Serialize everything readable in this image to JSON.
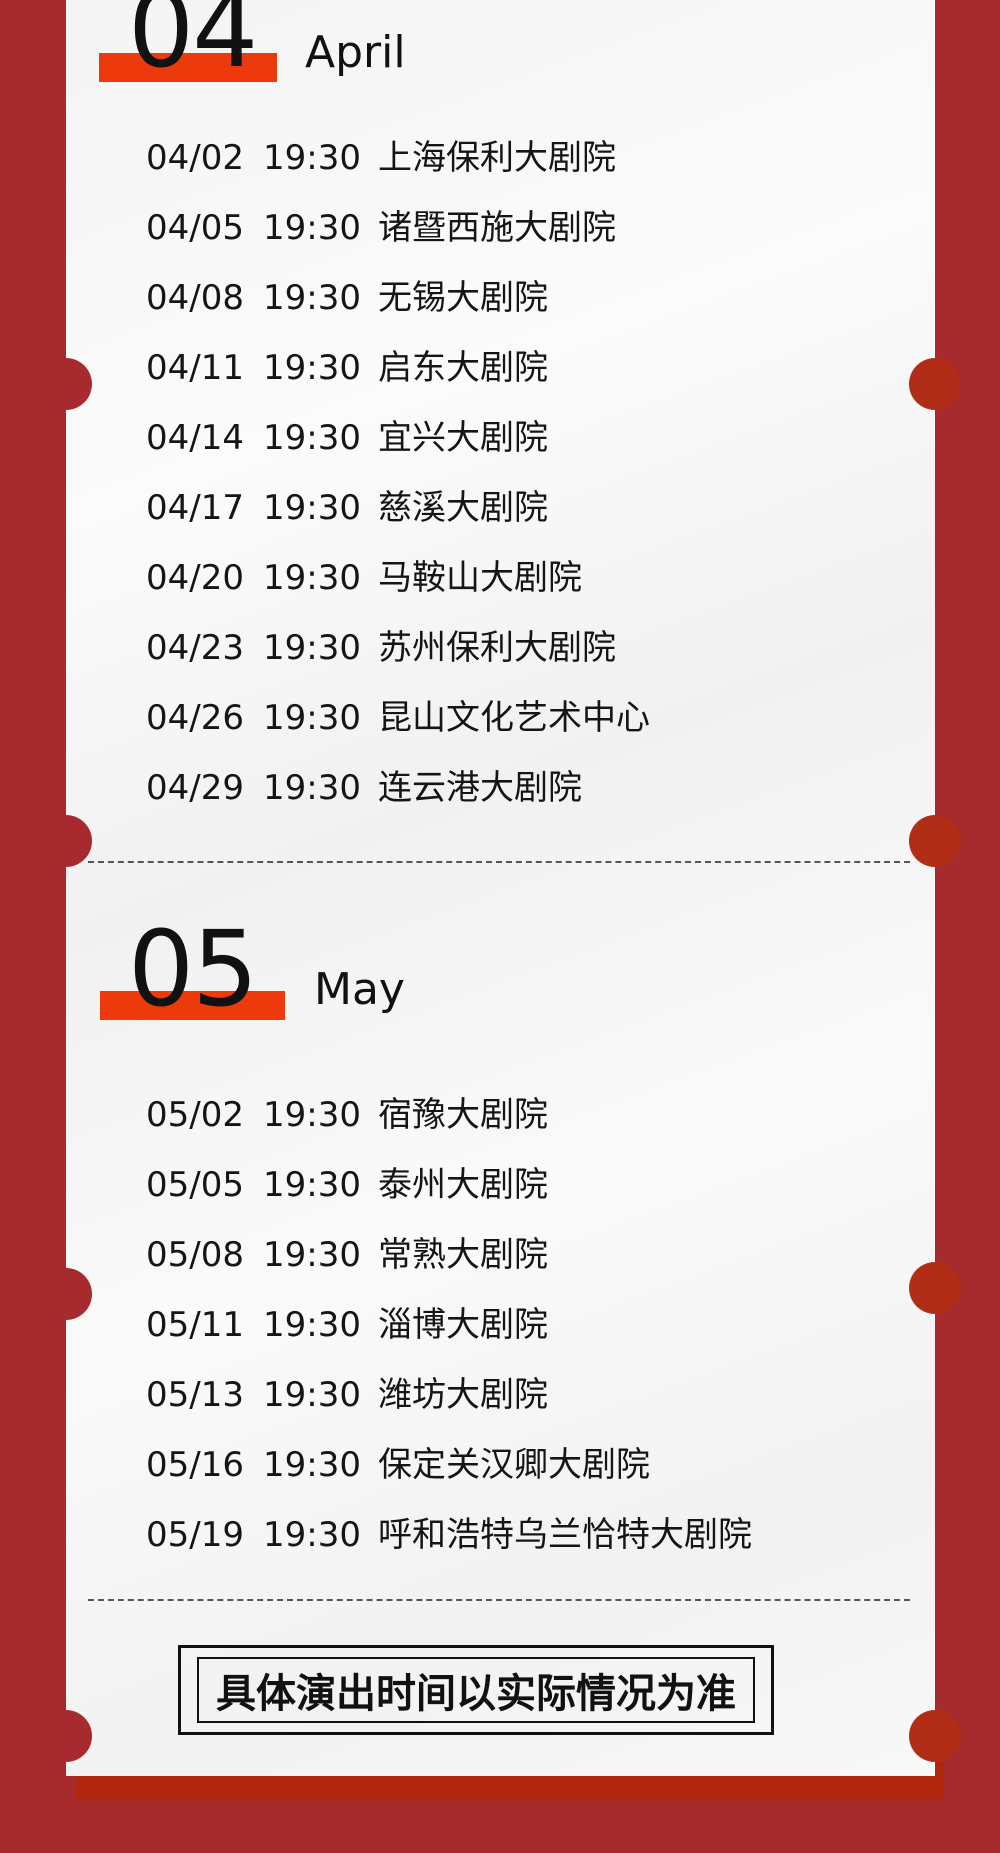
{
  "april": {
    "number": "04",
    "name": "April",
    "shows": [
      {
        "date": "04/02",
        "time": "19:30",
        "venue": "上海保利大剧院"
      },
      {
        "date": "04/05",
        "time": "19:30",
        "venue": "诸暨西施大剧院"
      },
      {
        "date": "04/08",
        "time": "19:30",
        "venue": "无锡大剧院"
      },
      {
        "date": "04/11",
        "time": "19:30",
        "venue": "启东大剧院"
      },
      {
        "date": "04/14",
        "time": "19:30",
        "venue": "宜兴大剧院"
      },
      {
        "date": "04/17",
        "time": "19:30",
        "venue": "慈溪大剧院"
      },
      {
        "date": "04/20",
        "time": "19:30",
        "venue": "马鞍山大剧院"
      },
      {
        "date": "04/23",
        "time": "19:30",
        "venue": "苏州保利大剧院"
      },
      {
        "date": "04/26",
        "time": "19:30",
        "venue": "昆山文化艺术中心"
      },
      {
        "date": "04/29",
        "time": "19:30",
        "venue": "连云港大剧院"
      }
    ]
  },
  "may": {
    "number": "05",
    "name": "May",
    "shows": [
      {
        "date": "05/02",
        "time": "19:30",
        "venue": "宿豫大剧院"
      },
      {
        "date": "05/05",
        "time": "19:30",
        "venue": "泰州大剧院"
      },
      {
        "date": "05/08",
        "time": "19:30",
        "venue": "常熟大剧院"
      },
      {
        "date": "05/11",
        "time": "19:30",
        "venue": "淄博大剧院"
      },
      {
        "date": "05/13",
        "time": "19:30",
        "venue": "潍坊大剧院"
      },
      {
        "date": "05/16",
        "time": "19:30",
        "venue": "保定关汉卿大剧院"
      },
      {
        "date": "05/19",
        "time": "19:30",
        "venue": "呼和浩特乌兰恰特大剧院"
      }
    ]
  },
  "footer": {
    "note": "具体演出时间以实际情况为准"
  },
  "colors": {
    "background": "#a72a2e",
    "accent": "#ec3a0c",
    "paper": "#f6f6f6"
  }
}
